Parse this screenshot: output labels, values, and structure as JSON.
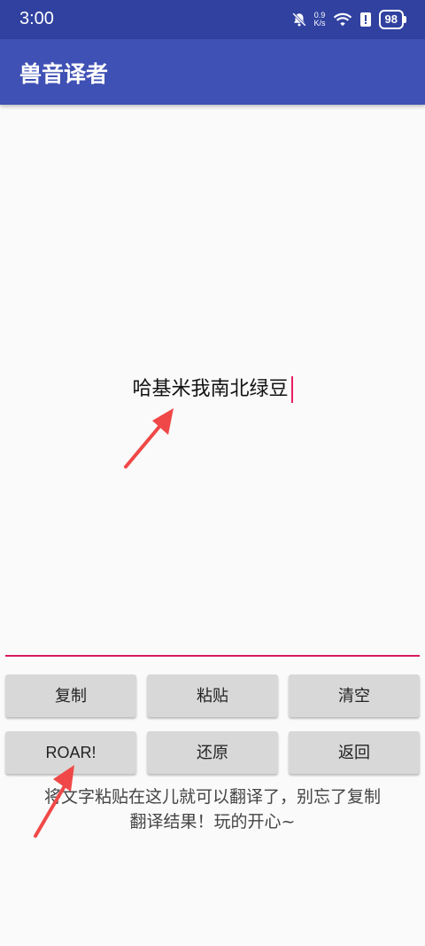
{
  "status_bar": {
    "time": "3:00",
    "net_speed_value": "0.9",
    "net_speed_unit": "K/s",
    "battery": "98",
    "icons": [
      "bell-muted-icon",
      "wifi-icon",
      "battery-saver-icon",
      "battery-icon"
    ]
  },
  "app_bar": {
    "title": "兽音译者"
  },
  "editor": {
    "text": "哈基米我南北绿豆"
  },
  "buttons": {
    "copy": "复制",
    "paste": "粘贴",
    "clear": "清空",
    "roar": "ROAR!",
    "restore": "还原",
    "back": "返回"
  },
  "hint": {
    "line1": "将文字粘贴在这儿就可以翻译了，别忘了复制",
    "line2": "翻译结果！玩的开心~"
  },
  "colors": {
    "status_bar": "#3041a0",
    "app_bar": "#3f51b5",
    "accent": "#d81b60",
    "annotation_arrow": "#f04848"
  }
}
